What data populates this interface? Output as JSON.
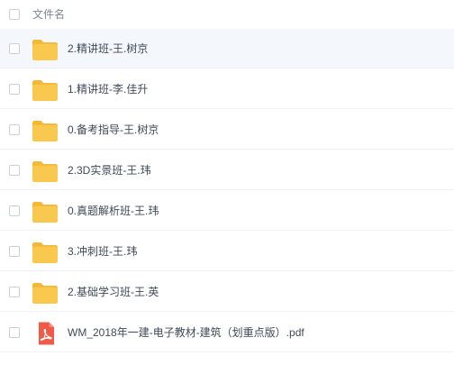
{
  "header": {
    "name_label": "文件名"
  },
  "rows": [
    {
      "name": "2.精讲班-王.树京",
      "icon": "folder-icon",
      "selected": true
    },
    {
      "name": "1.精讲班-李.佳升",
      "icon": "folder-icon",
      "selected": false
    },
    {
      "name": "0.备考指导-王.树京",
      "icon": "folder-icon",
      "selected": false
    },
    {
      "name": "2.3D实景班-王.玮",
      "icon": "folder-icon",
      "selected": false
    },
    {
      "name": "0.真题解析班-王.玮",
      "icon": "folder-icon",
      "selected": false
    },
    {
      "name": "3.冲刺班-王.玮",
      "icon": "folder-icon",
      "selected": false
    },
    {
      "name": "2.基础学习班-王.英",
      "icon": "folder-icon",
      "selected": false
    },
    {
      "name": "WM_2018年一建-电子教材-建筑（划重点版）.pdf",
      "icon": "pdf-icon",
      "selected": false
    }
  ],
  "colors": {
    "folder": "#f9c94f",
    "folder_back": "#f3b834",
    "pdf": "#f05a47",
    "selected_row": "#f4f8fd",
    "divider": "#eef1f5",
    "text": "#3f4a58",
    "header_text": "#7d8794"
  }
}
